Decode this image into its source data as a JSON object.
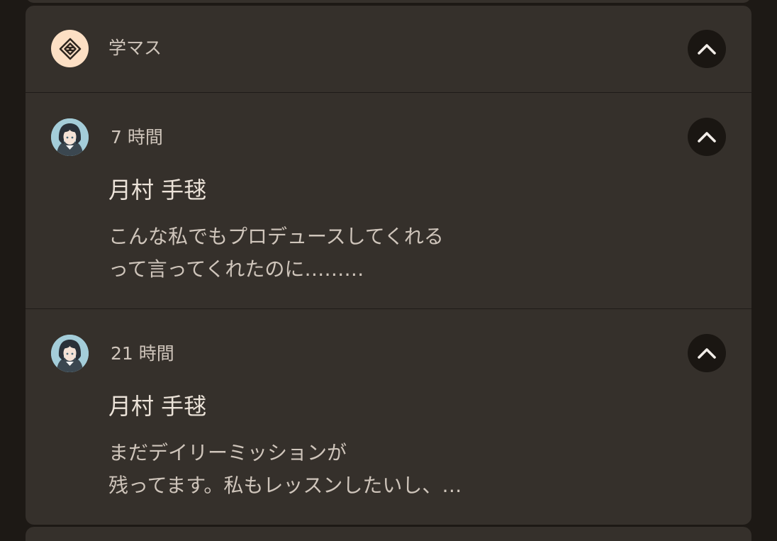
{
  "app": {
    "name": "学マス",
    "icon": "gakumasu-logo-icon",
    "icon_bg": "#fcdfc4"
  },
  "notifications": [
    {
      "time": "7 時間",
      "sender": "月村 手毬",
      "avatar": "character-avatar",
      "message_lines": [
        "こんな私でもプロデュースしてくれる",
        "って言ってくれたのに………"
      ]
    },
    {
      "time": "21 時間",
      "sender": "月村 手毬",
      "avatar": "character-avatar",
      "message_lines": [
        "まだデイリーミッションが",
        "残ってます。私もレッスンしたいし、…"
      ]
    }
  ],
  "icons": {
    "collapse": "chevron-up-icon"
  },
  "colors": {
    "background": "#1d1915",
    "card": "#35302b",
    "button": "#1a1612",
    "primary_text": "#ece3d9",
    "secondary_text": "#cfc5bb"
  }
}
